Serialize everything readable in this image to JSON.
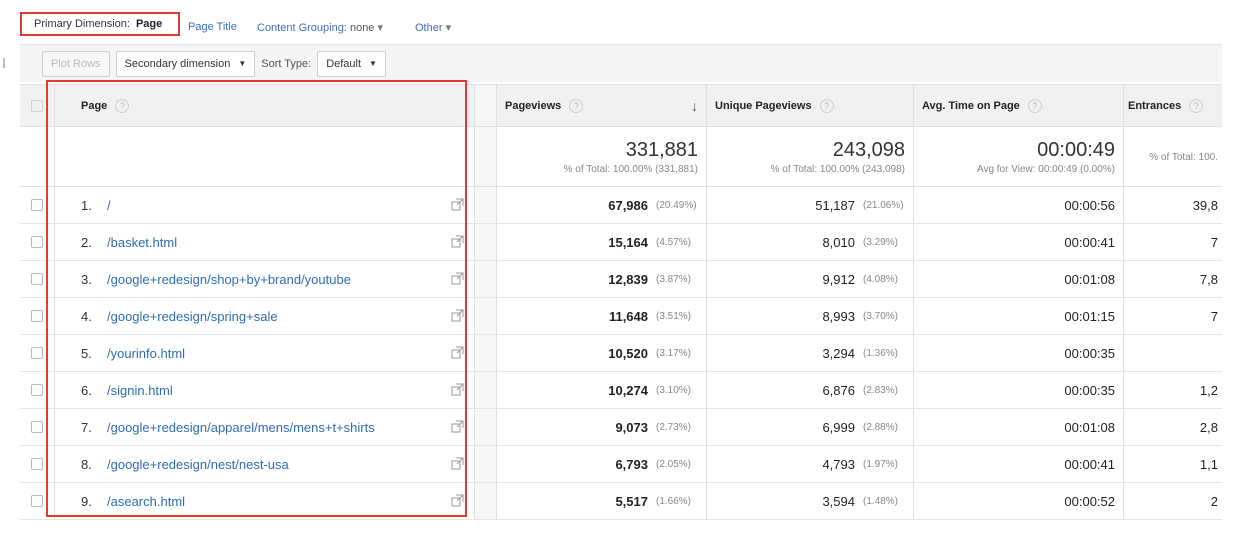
{
  "dimension_bar": {
    "primary_label": "Primary Dimension:",
    "primary_value": "Page",
    "page_title": "Page Title",
    "content_grouping_label": "Content Grouping:",
    "content_grouping_value": "none",
    "other": "Other"
  },
  "toolbar": {
    "plot_rows": "Plot Rows",
    "secondary_dimension": "Secondary dimension",
    "sort_type_label": "Sort Type:",
    "sort_type_value": "Default"
  },
  "table": {
    "headers": {
      "page": "Page",
      "pageviews": "Pageviews",
      "unique_pageviews": "Unique Pageviews",
      "avg_time": "Avg. Time on Page",
      "entrances": "Entrances"
    },
    "totals": {
      "pageviews": "331,881",
      "pageviews_sub": "% of Total: 100.00% (331,881)",
      "unique_pageviews": "243,098",
      "unique_pageviews_sub": "% of Total: 100.00% (243,098)",
      "avg_time": "00:00:49",
      "avg_time_sub": "Avg for View: 00:00:49 (0.00%)",
      "entrances_sub": "% of Total: 100."
    },
    "rows": [
      {
        "num": "1.",
        "page": "/",
        "pv": "67,986",
        "pv_pct": "(20.49%)",
        "upv": "51,187",
        "upv_pct": "(21.06%)",
        "time": "00:00:56",
        "ent": "39,8"
      },
      {
        "num": "2.",
        "page": "/basket.html",
        "pv": "15,164",
        "pv_pct": "(4.57%)",
        "upv": "8,010",
        "upv_pct": "(3.29%)",
        "time": "00:00:41",
        "ent": "7"
      },
      {
        "num": "3.",
        "page": "/google+redesign/shop+by+brand/youtube",
        "pv": "12,839",
        "pv_pct": "(3.87%)",
        "upv": "9,912",
        "upv_pct": "(4.08%)",
        "time": "00:01:08",
        "ent": "7,8"
      },
      {
        "num": "4.",
        "page": "/google+redesign/spring+sale",
        "pv": "11,648",
        "pv_pct": "(3.51%)",
        "upv": "8,993",
        "upv_pct": "(3.70%)",
        "time": "00:01:15",
        "ent": "7"
      },
      {
        "num": "5.",
        "page": "/yourinfo.html",
        "pv": "10,520",
        "pv_pct": "(3.17%)",
        "upv": "3,294",
        "upv_pct": "(1.36%)",
        "time": "00:00:35",
        "ent": ""
      },
      {
        "num": "6.",
        "page": "/signin.html",
        "pv": "10,274",
        "pv_pct": "(3.10%)",
        "upv": "6,876",
        "upv_pct": "(2.83%)",
        "time": "00:00:35",
        "ent": "1,2"
      },
      {
        "num": "7.",
        "page": "/google+redesign/apparel/mens/mens+t+shirts",
        "pv": "9,073",
        "pv_pct": "(2.73%)",
        "upv": "6,999",
        "upv_pct": "(2.88%)",
        "time": "00:01:08",
        "ent": "2,8"
      },
      {
        "num": "8.",
        "page": "/google+redesign/nest/nest-usa",
        "pv": "6,793",
        "pv_pct": "(2.05%)",
        "upv": "4,793",
        "upv_pct": "(1.97%)",
        "time": "00:00:41",
        "ent": "1,1"
      },
      {
        "num": "9.",
        "page": "/asearch.html",
        "pv": "5,517",
        "pv_pct": "(1.66%)",
        "upv": "3,594",
        "upv_pct": "(1.48%)",
        "time": "00:00:52",
        "ent": "2"
      }
    ]
  },
  "colors": {
    "highlight": "#e53935",
    "link": "#2e6db4"
  }
}
